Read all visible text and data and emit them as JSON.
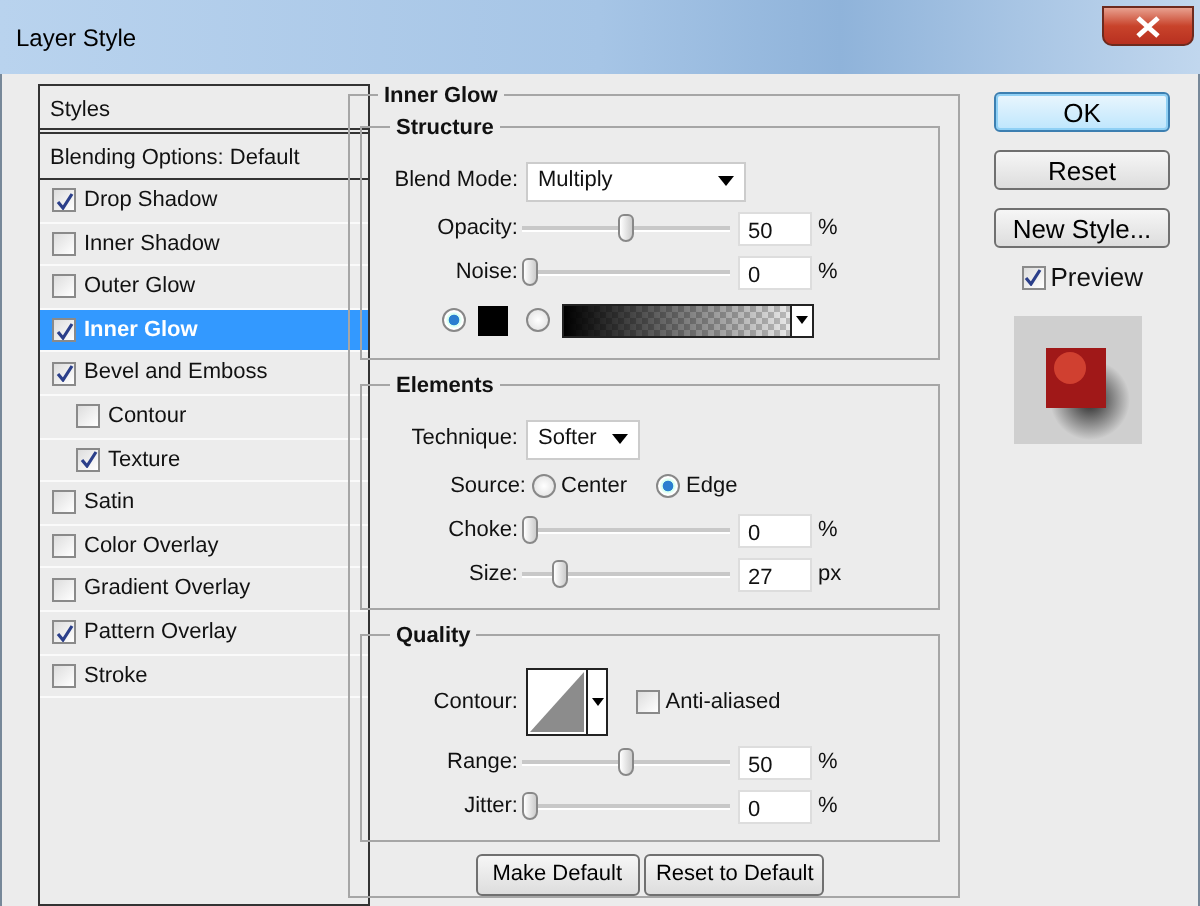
{
  "window": {
    "title": "Layer Style"
  },
  "styles_panel": {
    "header": "Styles",
    "blending_options": "Blending Options: Default",
    "items": [
      {
        "label": "Drop Shadow",
        "checked": true,
        "selected": false
      },
      {
        "label": "Inner Shadow",
        "checked": false,
        "selected": false
      },
      {
        "label": "Outer Glow",
        "checked": false,
        "selected": false
      },
      {
        "label": "Inner Glow",
        "checked": true,
        "selected": true
      },
      {
        "label": "Bevel and Emboss",
        "checked": true,
        "selected": false,
        "children": [
          {
            "label": "Contour",
            "checked": false,
            "selected": false
          },
          {
            "label": "Texture",
            "checked": true,
            "selected": false
          }
        ]
      },
      {
        "label": "Satin",
        "checked": false,
        "selected": false
      },
      {
        "label": "Color Overlay",
        "checked": false,
        "selected": false
      },
      {
        "label": "Gradient Overlay",
        "checked": false,
        "selected": false
      },
      {
        "label": "Pattern Overlay",
        "checked": true,
        "selected": false
      },
      {
        "label": "Stroke",
        "checked": false,
        "selected": false
      }
    ]
  },
  "inner_glow": {
    "title": "Inner Glow",
    "structure": {
      "title": "Structure",
      "blend_mode": {
        "label": "Blend Mode:",
        "value": "Multiply"
      },
      "sliders": [
        {
          "label": "Opacity:",
          "level": 0.5,
          "value": "50",
          "unit": "%"
        },
        {
          "label": "Noise:",
          "level": 0,
          "value": "0",
          "unit": "%"
        }
      ],
      "fill_options": [
        {
          "kind": "color",
          "selected": true
        },
        {
          "kind": "gradient",
          "selected": false
        }
      ]
    },
    "elements": {
      "title": "Elements",
      "technique": {
        "label": "Technique:",
        "value": "Softer"
      },
      "source": {
        "label": "Source:",
        "options": [
          {
            "label": "Center",
            "selected": false
          },
          {
            "label": "Edge",
            "selected": true
          }
        ]
      },
      "sliders": [
        {
          "label": "Choke:",
          "level": 0,
          "value": "0",
          "unit": "%"
        },
        {
          "label": "Size:",
          "level": 0.16,
          "value": "27",
          "unit": "px"
        }
      ]
    },
    "quality": {
      "title": "Quality",
      "contour": {
        "label": "Contour:"
      },
      "anti_aliased": {
        "label": "Anti-aliased",
        "checked": false
      },
      "sliders": [
        {
          "label": "Range:",
          "level": 0.5,
          "value": "50",
          "unit": "%"
        },
        {
          "label": "Jitter:",
          "level": 0,
          "value": "0",
          "unit": "%"
        }
      ]
    },
    "buttons": [
      "Make Default",
      "Reset to Default"
    ]
  },
  "actions": {
    "buttons": [
      {
        "label": "OK",
        "kind": "default"
      },
      {
        "label": "Reset",
        "kind": "normal"
      },
      {
        "label": "New Style...",
        "kind": "normal"
      }
    ],
    "preview": {
      "label": "Preview",
      "checked": true
    }
  }
}
